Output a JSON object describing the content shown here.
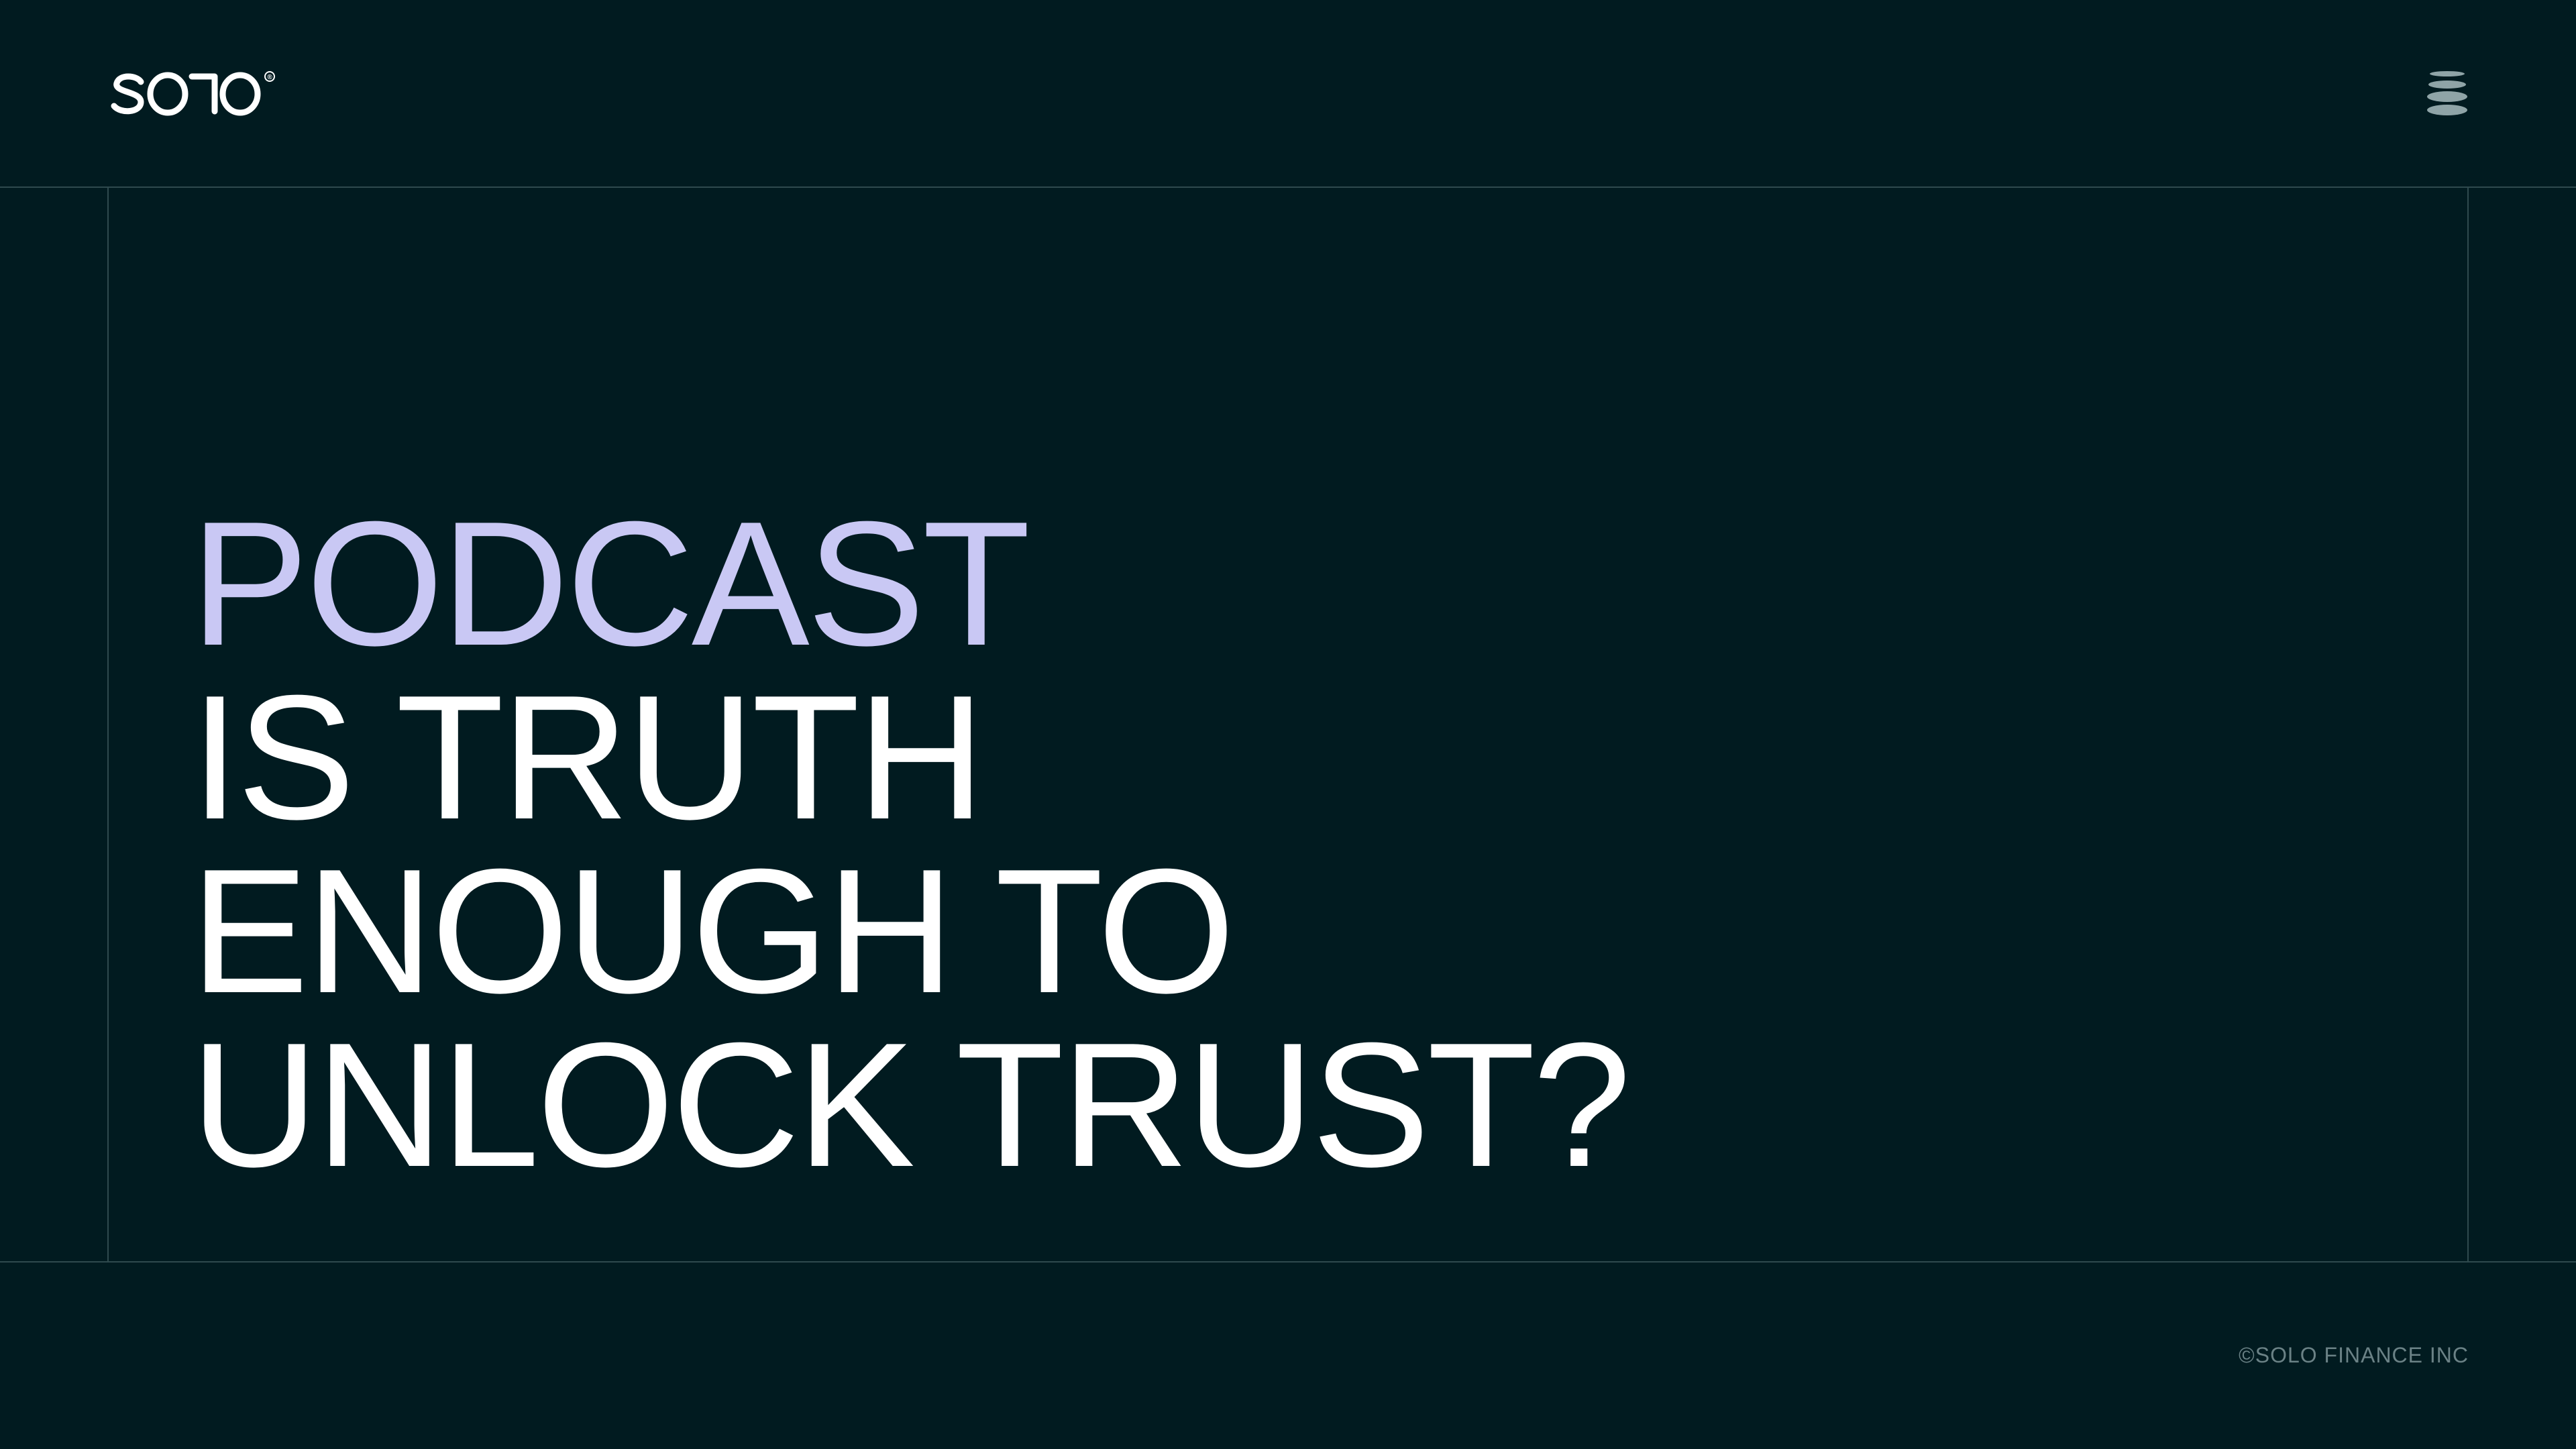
{
  "colors": {
    "background": "#011b20",
    "grid_line": "#2f4a4e",
    "accent": "#c9c8f4",
    "text": "#ffffff",
    "muted": "#6b8286"
  },
  "header": {
    "logo_text": "SOLO",
    "logo_registered": "®",
    "menu_icon": "stacked-discs-icon"
  },
  "hero": {
    "line1": "PODCAST",
    "line2": "IS TRUTH",
    "line3": "ENOUGH TO",
    "line4": "UNLOCK TRUST?"
  },
  "footer": {
    "copyright": "©SOLO FINANCE INC"
  }
}
